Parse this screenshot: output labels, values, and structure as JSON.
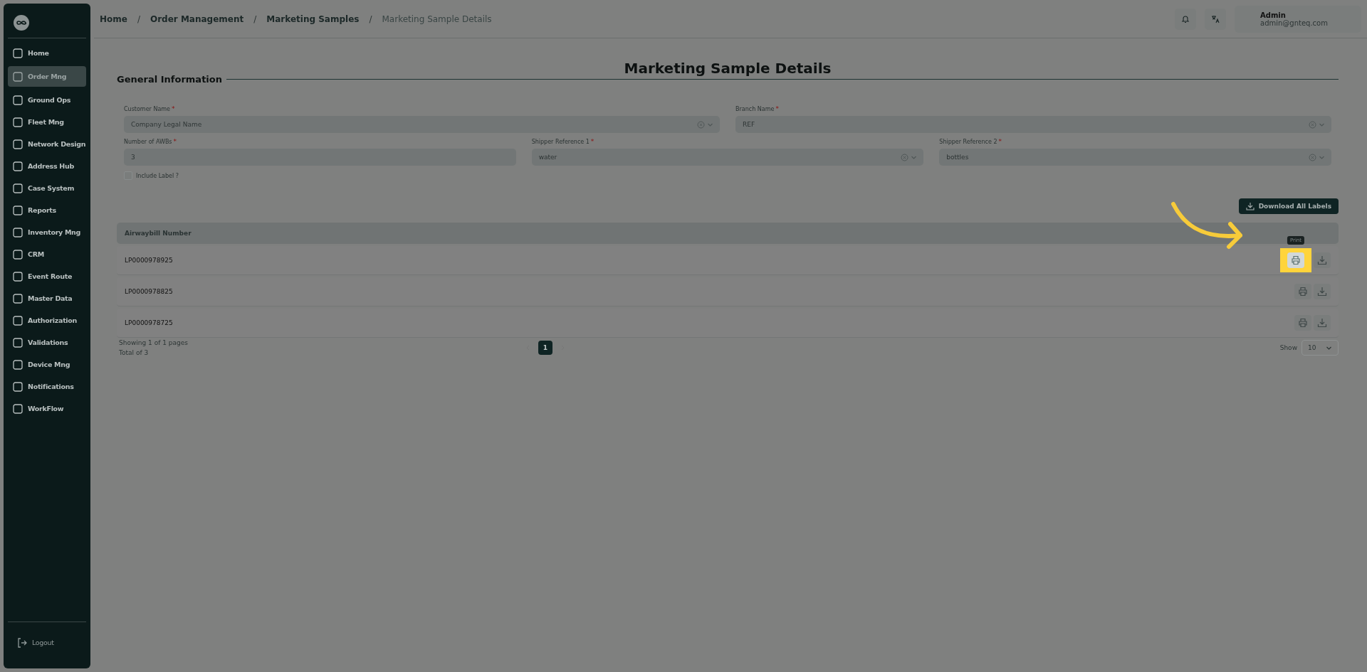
{
  "sidebar": {
    "items": [
      {
        "label": "Home",
        "selected": false
      },
      {
        "label": "Order Mng",
        "selected": true
      },
      {
        "label": "Ground Ops",
        "selected": false
      },
      {
        "label": "Fleet Mng",
        "selected": false
      },
      {
        "label": "Network Design",
        "selected": false
      },
      {
        "label": "Address Hub",
        "selected": false
      },
      {
        "label": "Case System",
        "selected": false
      },
      {
        "label": "Reports",
        "selected": false
      },
      {
        "label": "Inventory Mng",
        "selected": false
      },
      {
        "label": "CRM",
        "selected": false
      },
      {
        "label": "Event Route",
        "selected": false
      },
      {
        "label": "Master Data",
        "selected": false
      },
      {
        "label": "Authorization",
        "selected": false
      },
      {
        "label": "Validations",
        "selected": false
      },
      {
        "label": "Device Mng",
        "selected": false
      },
      {
        "label": "Notifications",
        "selected": false
      },
      {
        "label": "WorkFlow",
        "selected": false
      }
    ],
    "logout": "Logout"
  },
  "breadcrumb": {
    "separator": "/",
    "items": [
      "Home",
      "Order Management",
      "Marketing Samples",
      "Marketing Sample Details"
    ]
  },
  "user": {
    "name": "Admin",
    "email": "admin@gnteq.com"
  },
  "page_title": "Marketing Sample Details",
  "section_title": "General Information",
  "form": {
    "rows": [
      [
        {
          "label": "Customer Name",
          "required": true,
          "kind": "select",
          "placeholder": "Company Legal Name",
          "disabled": true
        },
        {
          "label": "Branch Name",
          "required": true,
          "kind": "select",
          "value": "REF",
          "disabled": true
        }
      ],
      [
        {
          "label": "Number of AWBs",
          "required": true,
          "kind": "input",
          "value": "3",
          "disabled": true
        },
        {
          "label": "Shipper Reference 1",
          "required": true,
          "kind": "select",
          "value": "water",
          "disabled": true
        },
        {
          "label": "Shipper Reference 2",
          "required": true,
          "kind": "select",
          "value": "bottles",
          "disabled": true
        }
      ]
    ],
    "checkbox": {
      "label": "Include Label ?",
      "checked": false
    },
    "required_mark": "*"
  },
  "download_button": "Download All Labels",
  "table": {
    "columns": [
      "Airwaybill Number"
    ],
    "rows": [
      {
        "awb": "LP0000978925",
        "highlighted": true,
        "tooltip": "Print"
      },
      {
        "awb": "LP0000978825",
        "highlighted": false
      },
      {
        "awb": "LP0000978725",
        "highlighted": false
      }
    ]
  },
  "pagination": {
    "summary": "Showing 1 of 1 pages",
    "total": "Total of 3",
    "pages": [
      {
        "label": "1",
        "selected": true
      }
    ],
    "show_label": "Show",
    "page_size": "10"
  }
}
